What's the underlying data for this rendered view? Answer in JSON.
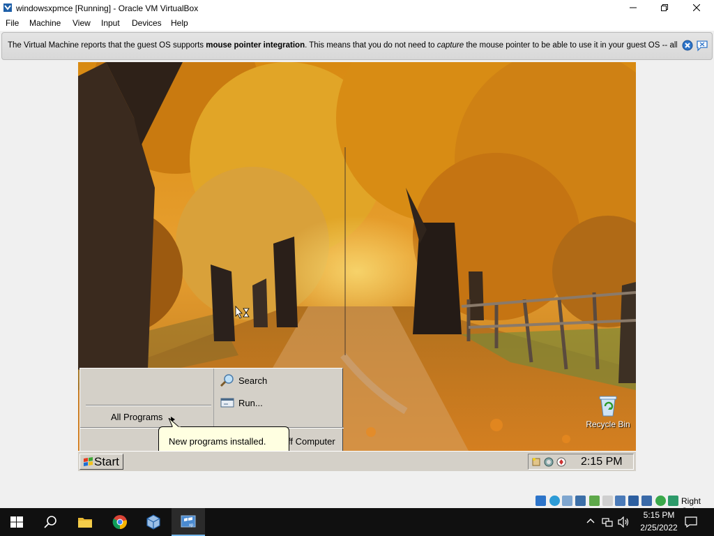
{
  "window": {
    "title": "windowsxpmce [Running] - Oracle VM VirtualBox",
    "controls": {
      "minimize": "—",
      "maximize": "☐",
      "close": "✕"
    }
  },
  "menu": [
    "File",
    "Machine",
    "View",
    "Input",
    "Devices",
    "Help"
  ],
  "notice": {
    "part1": "The Virtual Machine reports that the guest OS supports ",
    "bold": "mouse pointer integration",
    "part2": ". This means that you do not need to ",
    "italic": "capture",
    "part3": " the mouse pointer to be able to use it in your guest OS -- all mouse"
  },
  "guest": {
    "start_label": "Start",
    "start_menu": {
      "all_programs": "All Programs",
      "search": "Search",
      "run": "Run...",
      "turn_off": "Turn Off Computer",
      "turn_off_visible": "ff Computer"
    },
    "balloon": "New programs installed.",
    "recycle_bin": "Recycle Bin",
    "clock": "2:15 PM"
  },
  "vbox_status": {
    "host_key": "Right Ctrl"
  },
  "host_taskbar": {
    "time": "5:15 PM",
    "date": "2/25/2022",
    "apps": [
      "start",
      "search",
      "file-explorer",
      "chrome",
      "virtualbox",
      "windowsxpmce"
    ]
  },
  "colors": {
    "host_taskbar": "#101010",
    "notice_bg": "#dcdcdc",
    "xp_taskbar": "#d4d0c8",
    "balloon_bg": "#ffffe1",
    "accent": "#76b9ed"
  }
}
